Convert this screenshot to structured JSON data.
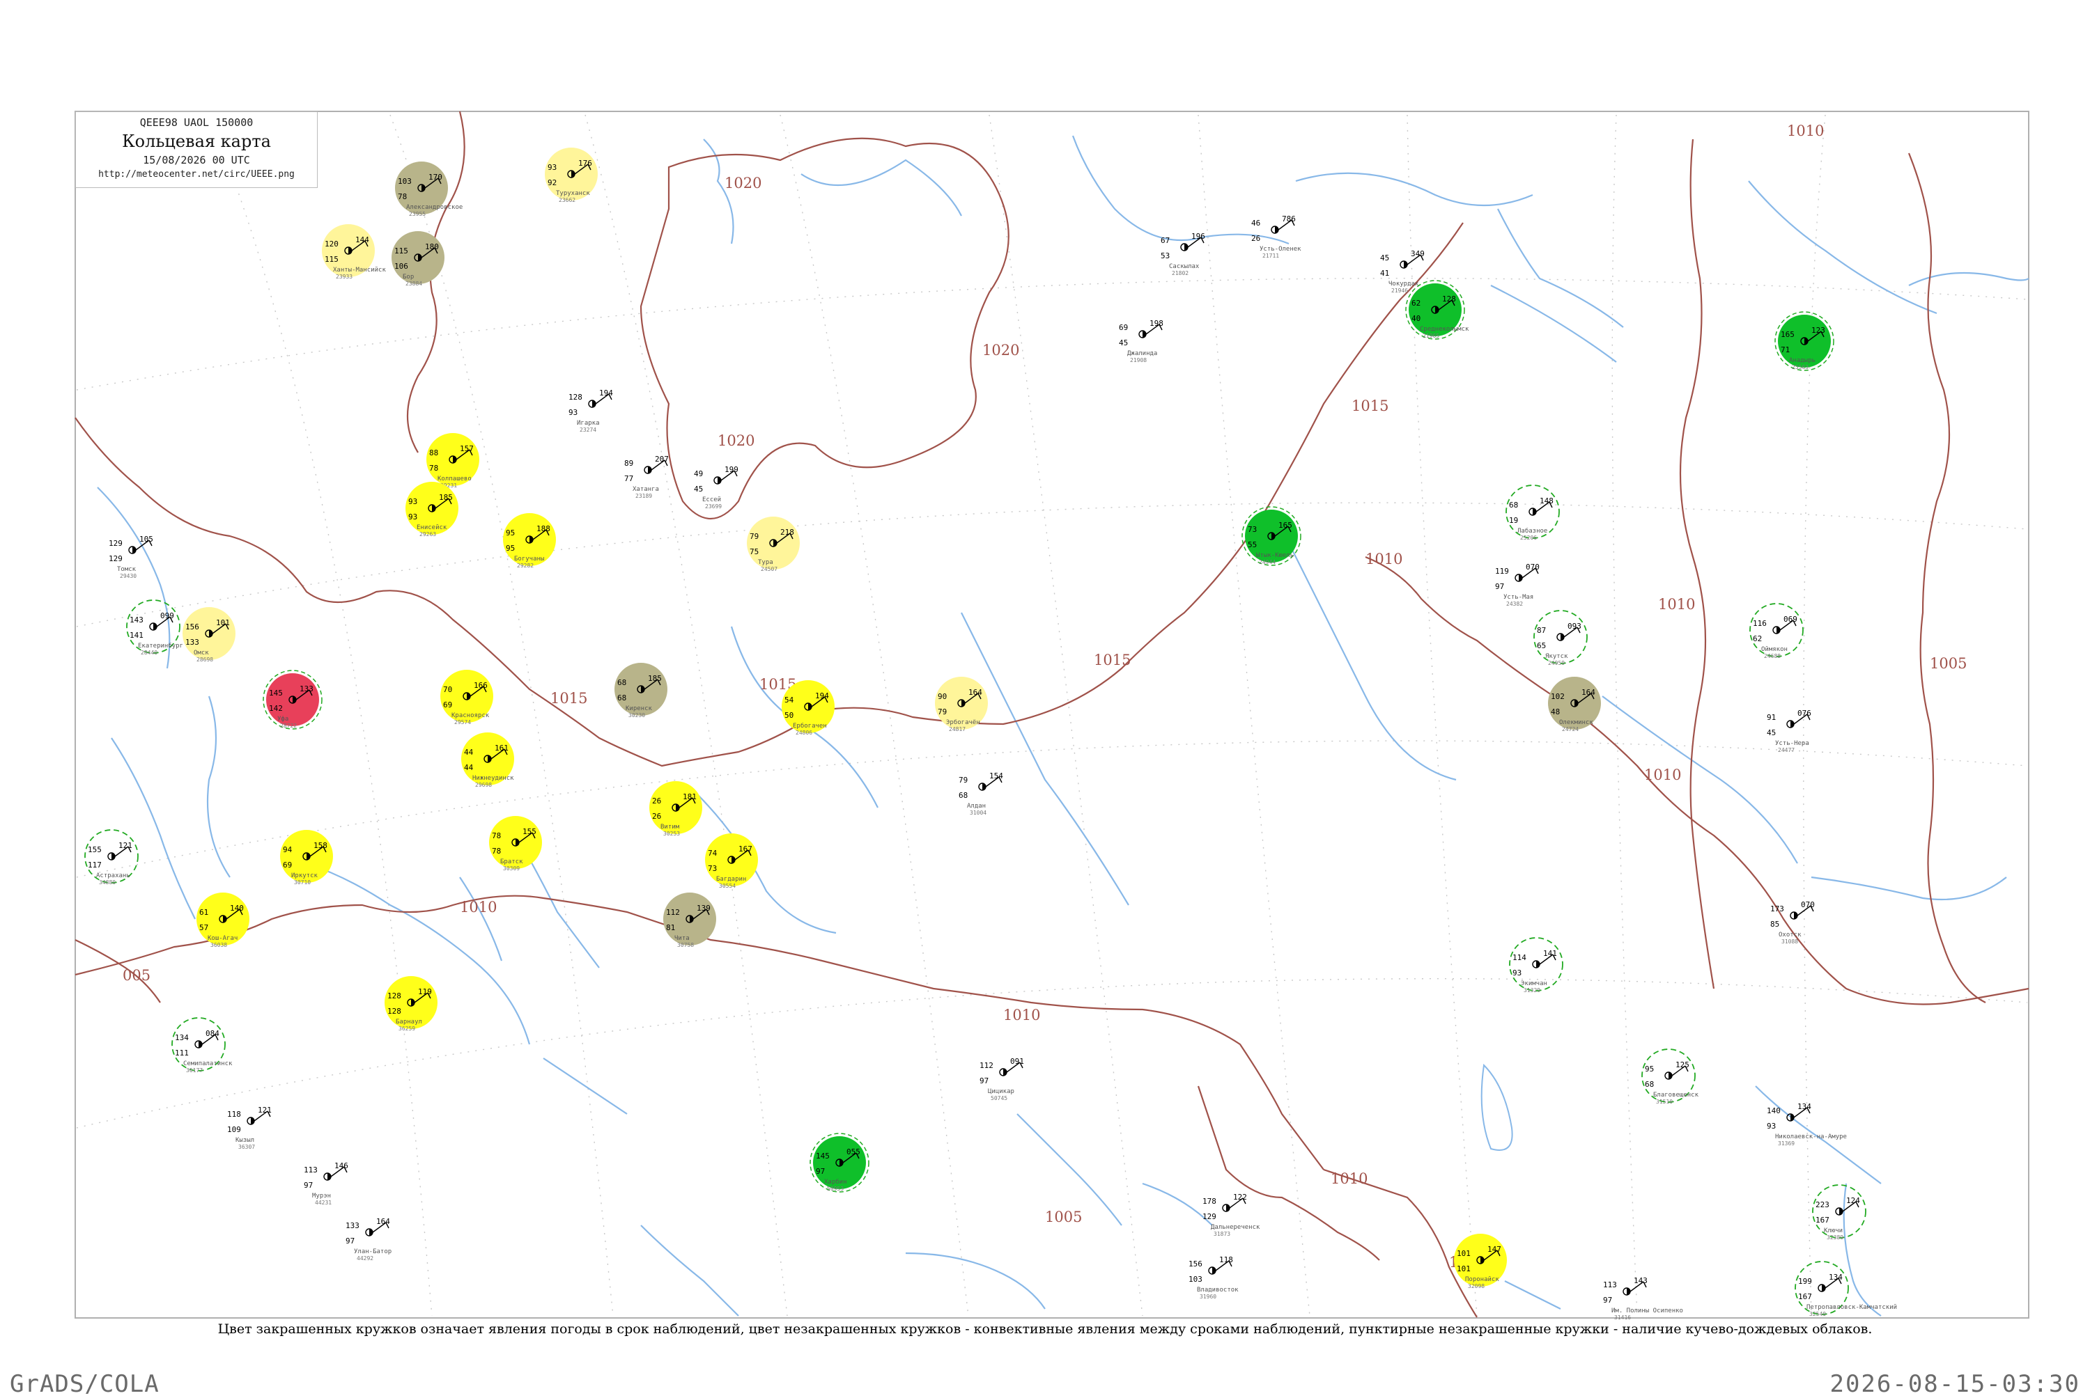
{
  "header": {
    "code": "QEEE98  UAOL  150000",
    "title": "Кольцевая карта",
    "date": "15/08/2026 00 UTC",
    "url": "http://meteocenter.net/circ/UEEE.png"
  },
  "caption": "Цвет закрашенных кружков означает явления погоды в срок наблюдений, цвет незакрашенных кружков - конвективные явления между сроками наблюдений, пунктирные незакрашенные кружки - наличие кучево-дождевых облаков.",
  "footer": {
    "left": "GrADS/COLA",
    "right": "2026-08-15-03:30"
  },
  "colors": {
    "isobar": "#a0524a",
    "river": "#88b8e8",
    "fill_yellow": "#ffff1a",
    "fill_light_yellow": "#fff59a",
    "fill_olive": "#b8b48a",
    "fill_green": "#0fbf2a",
    "fill_red": "#e8405a",
    "ring_green": "#22aa22"
  },
  "isobar_labels": [
    "1020",
    "1020",
    "1020",
    "1015",
    "1015",
    "1015",
    "1015",
    "1010",
    "1010",
    "1010",
    "1010",
    "1010",
    "1010",
    "1010",
    "1005",
    "1005",
    "005",
    "1010"
  ],
  "stations": [
    {
      "id": "21711",
      "name": "Усть-Оленек",
      "p": "786",
      "t": "46",
      "td": "26",
      "mark": "none"
    },
    {
      "id": "21802",
      "name": "Саскылах",
      "p": "196",
      "t": "67",
      "td": "53",
      "mark": "none"
    },
    {
      "id": "21908",
      "name": "Джалинда",
      "p": "198",
      "t": "69",
      "td": "45",
      "mark": "none"
    },
    {
      "id": "21946",
      "name": "Чокурдах",
      "p": "349",
      "t": "45",
      "td": "41",
      "mark": "none"
    },
    {
      "id": "21965",
      "name": "Среднеколымск",
      "p": "128",
      "t": "62",
      "td": "40",
      "mark": "green"
    },
    {
      "id": "25206",
      "name": "Лабазное",
      "p": "148",
      "t": "68",
      "td": "19",
      "mark": "ring"
    },
    {
      "id": "24944",
      "name": "Ытык-Кюель",
      "p": "165",
      "t": "73",
      "td": "55",
      "mark": "green"
    },
    {
      "id": "24382",
      "name": "Усть-Мая",
      "p": "070",
      "t": "119",
      "td": "97",
      "mark": "none"
    },
    {
      "id": "24688",
      "name": "Оймякон",
      "p": "069",
      "t": "116",
      "td": "62",
      "mark": "ring"
    },
    {
      "id": "24477",
      "name": "Усть-Нера",
      "p": "076",
      "t": "91",
      "td": "45",
      "mark": "none"
    },
    {
      "id": "24959",
      "name": "Якутск",
      "p": "093",
      "t": "87",
      "td": "65",
      "mark": "ring"
    },
    {
      "id": "24724",
      "name": "Олекминск",
      "p": "164",
      "t": "102",
      "td": "48",
      "mark": "olive"
    },
    {
      "id": "24817",
      "name": "Эрбогачён",
      "p": "164",
      "t": "90",
      "td": "79",
      "mark": "light-yellow"
    },
    {
      "id": "24806",
      "name": "Ербогачен",
      "p": "194",
      "t": "54",
      "td": "50",
      "mark": "yellow"
    },
    {
      "id": "24507",
      "name": "Тура",
      "p": "218",
      "t": "79",
      "td": "75",
      "mark": "light-yellow"
    },
    {
      "id": "23699",
      "name": "Ессей",
      "p": "199",
      "t": "49",
      "td": "45",
      "mark": "none"
    },
    {
      "id": "23189",
      "name": "Хатанга",
      "p": "207",
      "t": "89",
      "td": "77",
      "mark": "none"
    },
    {
      "id": "23274",
      "name": "Игарка",
      "p": "194",
      "t": "128",
      "td": "93",
      "mark": "none"
    },
    {
      "id": "23662",
      "name": "Туруханск",
      "p": "176",
      "t": "93",
      "td": "92",
      "mark": "light-yellow"
    },
    {
      "id": "23933",
      "name": "Ханты-Мансийск",
      "p": "144",
      "t": "120",
      "td": "115",
      "mark": "light-yellow"
    },
    {
      "id": "23955",
      "name": "Александровское",
      "p": "170",
      "t": "103",
      "td": "78",
      "mark": "olive"
    },
    {
      "id": "23884",
      "name": "Бор",
      "p": "180",
      "t": "115",
      "td": "106",
      "mark": "olive"
    },
    {
      "id": "29231",
      "name": "Колпашево",
      "p": "157",
      "t": "88",
      "td": "78",
      "mark": "yellow"
    },
    {
      "id": "29282",
      "name": "Богучаны",
      "p": "188",
      "t": "95",
      "td": "95",
      "mark": "yellow"
    },
    {
      "id": "29263",
      "name": "Енисейск",
      "p": "185",
      "t": "93",
      "td": "93",
      "mark": "yellow"
    },
    {
      "id": "29430",
      "name": "Томск",
      "p": "105",
      "t": "129",
      "td": "129",
      "mark": "none"
    },
    {
      "id": "29574",
      "name": "Красноярск",
      "p": "166",
      "t": "70",
      "td": "69",
      "mark": "yellow"
    },
    {
      "id": "29698",
      "name": "Нижнеудинск",
      "p": "161",
      "t": "44",
      "td": "44",
      "mark": "yellow"
    },
    {
      "id": "30230",
      "name": "Киренск",
      "p": "185",
      "t": "68",
      "td": "68",
      "mark": "olive"
    },
    {
      "id": "30309",
      "name": "Братск",
      "p": "155",
      "t": "78",
      "td": "78",
      "mark": "yellow"
    },
    {
      "id": "30554",
      "name": "Багдарин",
      "p": "167",
      "t": "74",
      "td": "73",
      "mark": "yellow"
    },
    {
      "id": "30253",
      "name": "Витим",
      "p": "181",
      "t": "26",
      "td": "26",
      "mark": "yellow"
    },
    {
      "id": "30710",
      "name": "Иркутск",
      "p": "158",
      "t": "94",
      "td": "69",
      "mark": "yellow"
    },
    {
      "id": "30758",
      "name": "Чита",
      "p": "139",
      "t": "112",
      "td": "81",
      "mark": "olive"
    },
    {
      "id": "31088",
      "name": "Охотск",
      "p": "070",
      "t": "173",
      "td": "85",
      "mark": "none"
    },
    {
      "id": "31329",
      "name": "Экимчан",
      "p": "141",
      "t": "114",
      "td": "93",
      "mark": "ring"
    },
    {
      "id": "31510",
      "name": "Благовещенск",
      "p": "125",
      "t": "95",
      "td": "68",
      "mark": "ring"
    },
    {
      "id": "31416",
      "name": "Им. Полины Осипенко",
      "p": "143",
      "t": "113",
      "td": "97",
      "mark": "none"
    },
    {
      "id": "36038",
      "name": "Кош-Агач",
      "p": "140",
      "t": "61",
      "td": "57",
      "mark": "yellow"
    },
    {
      "id": "36177",
      "name": "Семипалатинск",
      "p": "084",
      "t": "134",
      "td": "111",
      "mark": "ring"
    },
    {
      "id": "36259",
      "name": "Барнаул",
      "p": "119",
      "t": "128",
      "td": "128",
      "mark": "yellow"
    },
    {
      "id": "36307",
      "name": "Кызыл",
      "p": "121",
      "t": "118",
      "td": "109",
      "mark": "none"
    },
    {
      "id": "28698",
      "name": "Омск",
      "p": "101",
      "t": "156",
      "td": "133",
      "mark": "light-yellow"
    },
    {
      "id": "28440",
      "name": "Екатеринбург",
      "p": "099",
      "t": "143",
      "td": "141",
      "mark": "ring"
    },
    {
      "id": "28722",
      "name": "Уфа",
      "p": "133",
      "t": "145",
      "td": "142",
      "mark": "red"
    },
    {
      "id": "34880",
      "name": "Астрахань",
      "p": "121",
      "t": "155",
      "td": "117",
      "mark": "ring"
    },
    {
      "id": "44231",
      "name": "Мурэн",
      "p": "146",
      "t": "113",
      "td": "97",
      "mark": "none"
    },
    {
      "id": "44292",
      "name": "Улан-Батор",
      "p": "164",
      "t": "133",
      "td": "97",
      "mark": "none"
    },
    {
      "id": "50745",
      "name": "Цицикар",
      "p": "091",
      "t": "112",
      "td": "97",
      "mark": "none"
    },
    {
      "id": "50953",
      "name": "Харбин",
      "p": "055",
      "t": "145",
      "td": "97",
      "mark": "green"
    },
    {
      "id": "31873",
      "name": "Дальнереченск",
      "p": "122",
      "t": "178",
      "td": "129",
      "mark": "none"
    },
    {
      "id": "31960",
      "name": "Владивосток",
      "p": "118",
      "t": "156",
      "td": "103",
      "mark": "none"
    },
    {
      "id": "32098",
      "name": "Поронайск",
      "p": "147",
      "t": "101",
      "td": "101",
      "mark": "yellow"
    },
    {
      "id": "32389",
      "name": "Ключи",
      "p": "124",
      "t": "223",
      "td": "167",
      "mark": "ring"
    },
    {
      "id": "32540",
      "name": "Петропавловск-Камчатский",
      "p": "134",
      "t": "199",
      "td": "167",
      "mark": "ring"
    },
    {
      "id": "25563",
      "name": "Анадырь",
      "p": "123",
      "t": "165",
      "td": "71",
      "mark": "green"
    },
    {
      "id": "31369",
      "name": "Николаевск-на-Амуре",
      "p": "134",
      "t": "140",
      "td": "93",
      "mark": "none"
    },
    {
      "id": "31004",
      "name": "Алдан",
      "p": "154",
      "t": "79",
      "td": "68",
      "mark": "none"
    }
  ]
}
